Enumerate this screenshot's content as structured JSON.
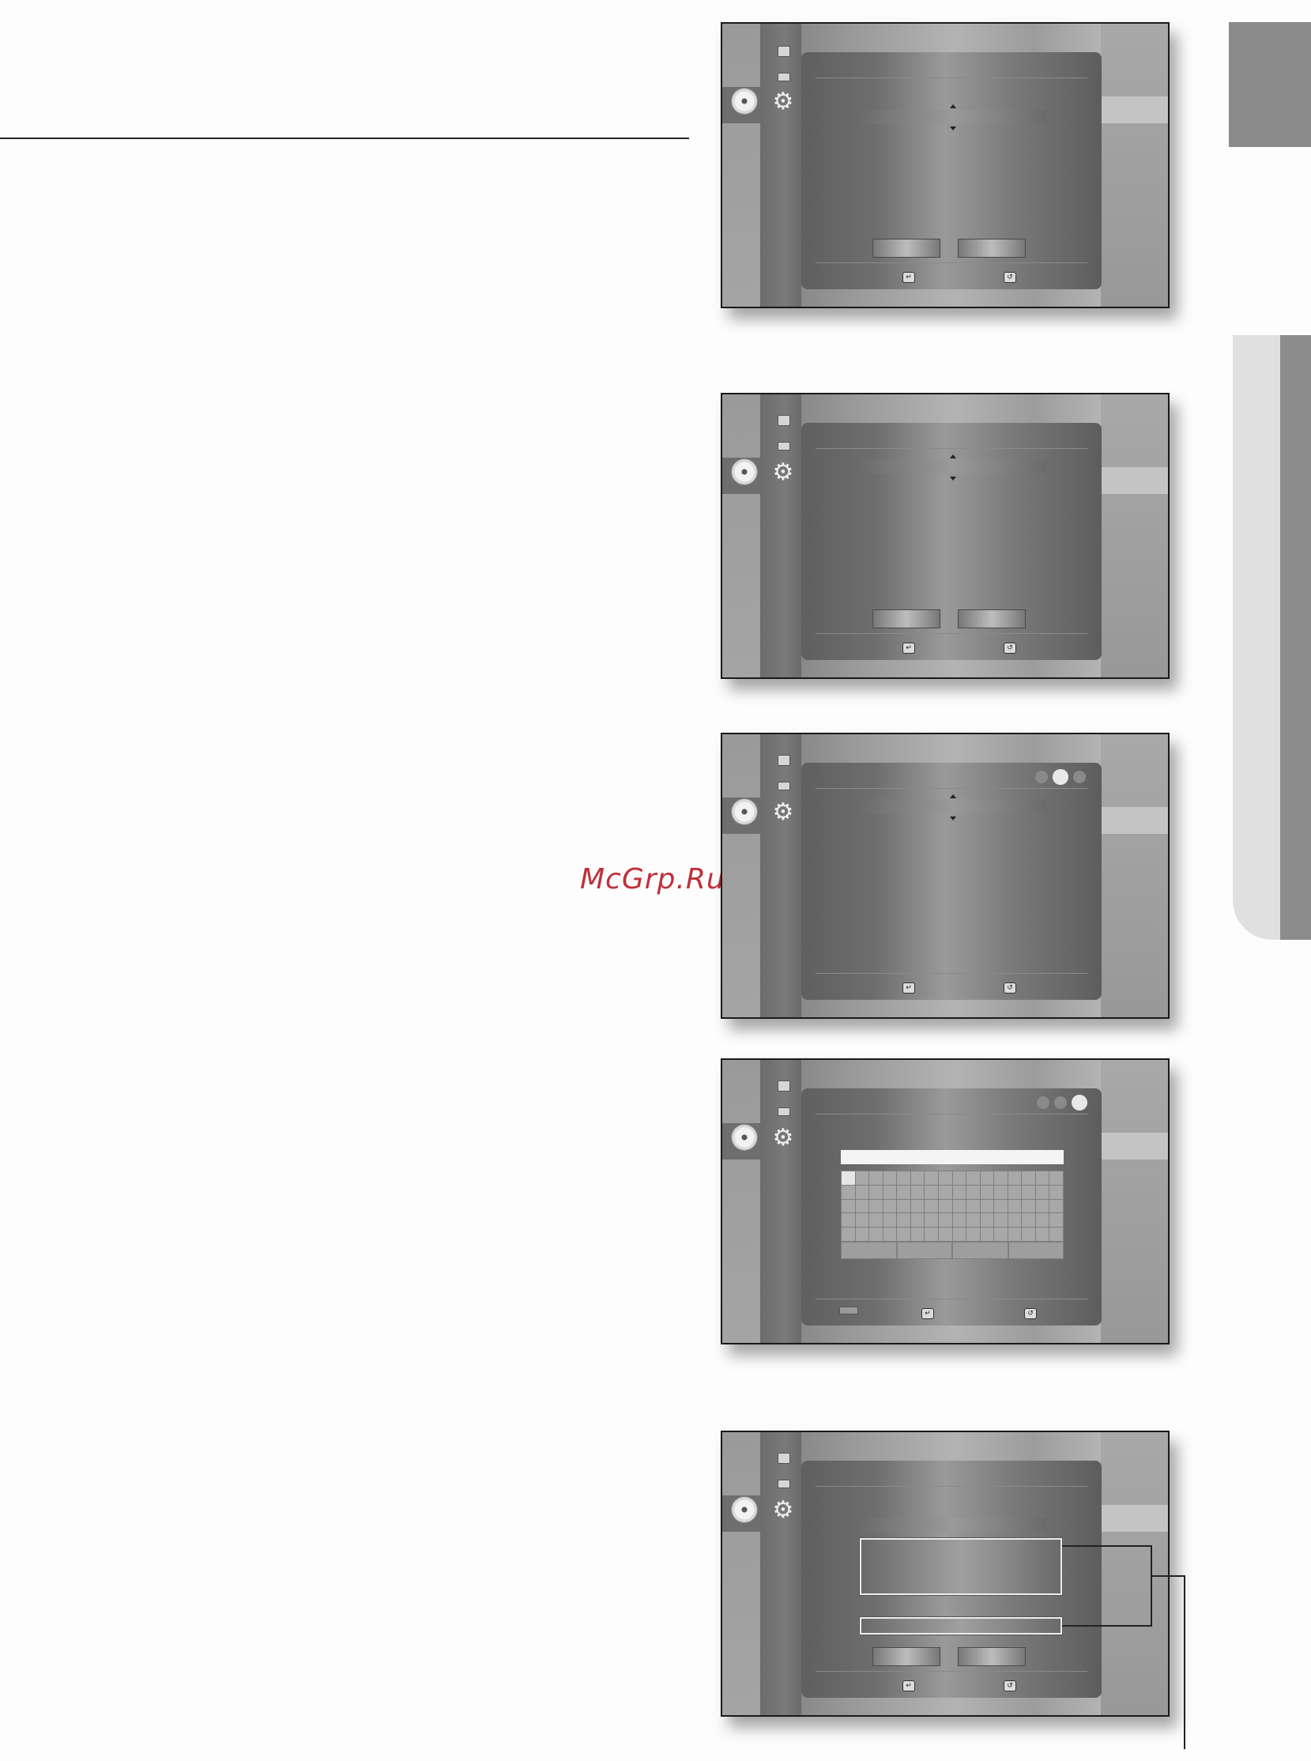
{
  "watermark": "McGrp.Ru",
  "screens": [
    {
      "id": 1,
      "keys": {
        "enter": "↵",
        "return": "↺"
      }
    },
    {
      "id": 2,
      "keys": {
        "enter": "↵",
        "return": "↺"
      }
    },
    {
      "id": 3,
      "keys": {
        "enter": "↵",
        "return": "↺"
      },
      "steps_total": 3,
      "step_active": 2
    },
    {
      "id": 4,
      "keys": {
        "enter": "↵",
        "return": "↺"
      },
      "steps_total": 3,
      "step_active": 3
    },
    {
      "id": 5,
      "keys": {
        "enter": "↵",
        "return": "↺"
      }
    }
  ]
}
